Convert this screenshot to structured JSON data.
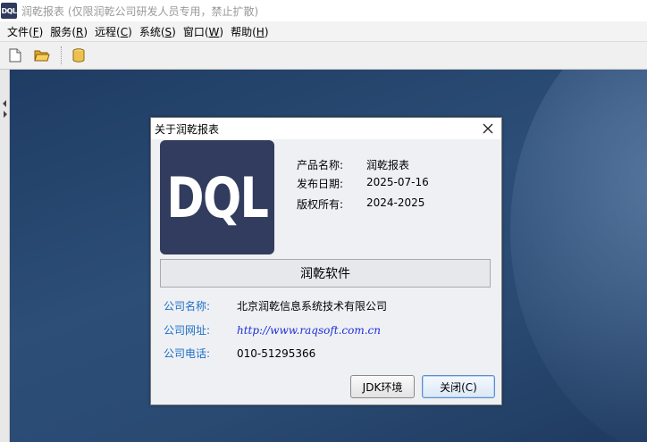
{
  "window": {
    "logo_text": "DQL",
    "title": "润乾报表 (仅限润乾公司研发人员专用，禁止扩散)"
  },
  "menu": [
    {
      "label": "文件",
      "key": "F"
    },
    {
      "label": "服务",
      "key": "R"
    },
    {
      "label": "远程",
      "key": "C"
    },
    {
      "label": "系统",
      "key": "S"
    },
    {
      "label": "窗口",
      "key": "W"
    },
    {
      "label": "帮助",
      "key": "H"
    }
  ],
  "toolbar": {
    "icons": [
      "new-document-icon",
      "open-folder-icon",
      "database-icon"
    ]
  },
  "dialog": {
    "title": "关于润乾报表",
    "logo_text": "DQL",
    "product": {
      "name_label": "产品名称:",
      "name_value": "润乾报表",
      "date_label": "发布日期:",
      "date_value": "2025-07-16",
      "copyright_label": "版权所有:",
      "copyright_value": "2024-2025"
    },
    "company_button": "润乾软件",
    "company": {
      "name_label": "公司名称:",
      "name_value": "北京润乾信息系统技术有限公司",
      "site_label": "公司网址:",
      "site_value": "http://www.raqsoft.com.cn",
      "phone_label": "公司电话:",
      "phone_value": "010-51295366"
    },
    "buttons": {
      "jdk": "JDK环境",
      "close": "关闭(C)"
    }
  },
  "colors": {
    "logo_bg": "#323c5e",
    "label_blue": "#1e6fc3",
    "link_blue": "#1f2fd6",
    "desktop_bg": "#2c4e77"
  }
}
